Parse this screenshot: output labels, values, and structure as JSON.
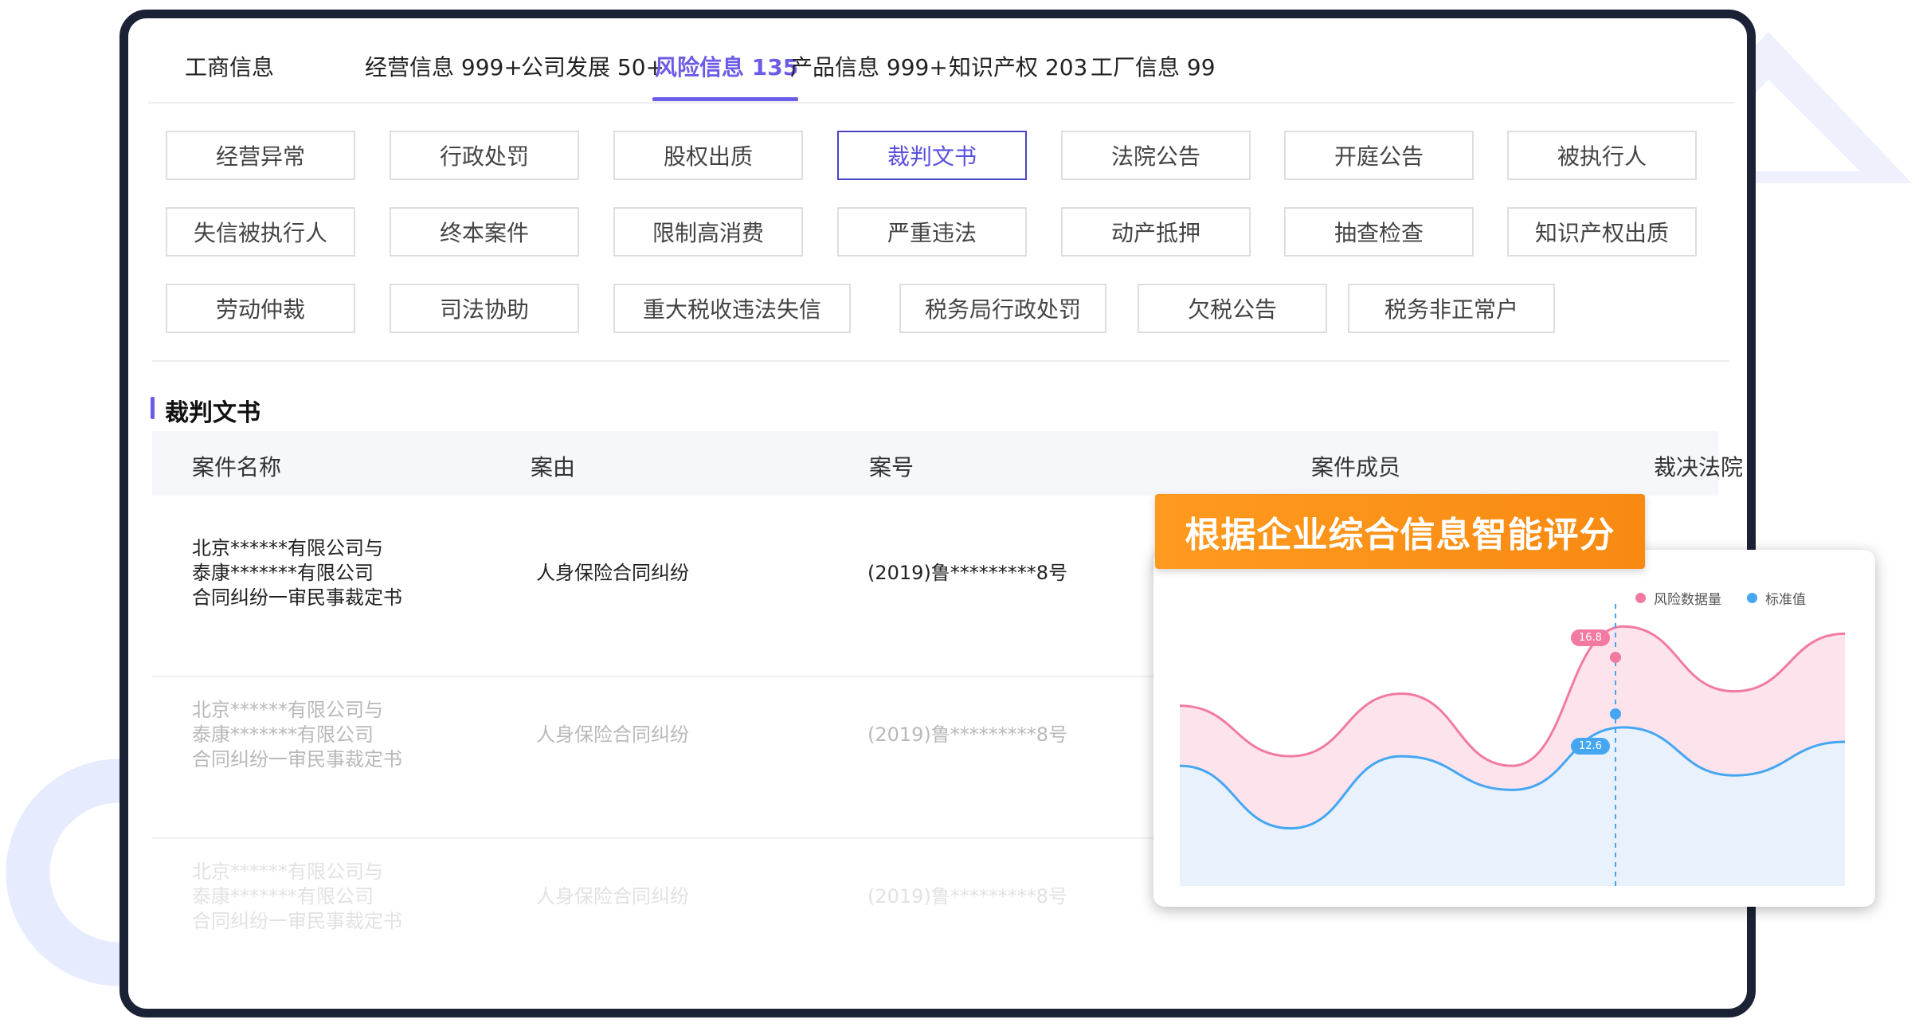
{
  "tabs": [
    {
      "label": "工商信息",
      "active": false
    },
    {
      "label": "经营信息 999+",
      "active": false
    },
    {
      "label": "公司发展 50+",
      "active": false
    },
    {
      "label": "风险信息 135",
      "active": true
    },
    {
      "label": "产品信息 999+",
      "active": false
    },
    {
      "label": "知识产权 203",
      "active": false
    },
    {
      "label": "工厂信息 99",
      "active": false
    }
  ],
  "categories": [
    [
      "经营异常",
      "行政处罚",
      "股权出质",
      "裁判文书",
      "法院公告",
      "开庭公告",
      "被执行人"
    ],
    [
      "失信被执行人",
      "终本案件",
      "限制高消费",
      "严重违法",
      "动产抵押",
      "抽查检查",
      "知识产权出质"
    ],
    [
      "劳动仲裁",
      "司法协助",
      "重大税收违法失信",
      "税务局行政处罚",
      "欠税公告",
      "税务非正常户"
    ]
  ],
  "active_category": "裁判文书",
  "section_title": "裁判文书",
  "table": {
    "headers": [
      "案件名称",
      "案由",
      "案号",
      "案件成员",
      "裁决法院"
    ],
    "rows": [
      {
        "name": [
          "北京******有限公司与",
          "泰康*******有限公司",
          "合同纠纷一审民事裁定书"
        ],
        "cause": "人身保险合同纠纷",
        "case_no": "(2019)鲁*********8号"
      },
      {
        "name": [
          "北京******有限公司与",
          "泰康*******有限公司",
          "合同纠纷一审民事裁定书"
        ],
        "cause": "人身保险合同纠纷",
        "case_no": "(2019)鲁*********8号"
      },
      {
        "name": [
          "北京******有限公司与",
          "泰康*******有限公司",
          "合同纠纷一审民事裁定书"
        ],
        "cause": "人身保险合同纠纷",
        "case_no": "(2019)鲁*********8号"
      }
    ]
  },
  "promo_badge": "根据企业综合信息智能评分",
  "colors": {
    "accent": "#6b5ce7",
    "risk": "#f27aa0",
    "standard": "#45a6f2",
    "badge": "#ff9a1f",
    "frame": "#1c2235"
  },
  "chart_data": {
    "type": "area",
    "legend": [
      {
        "name": "风险数据量",
        "color": "#f27aa0"
      },
      {
        "name": "标准值",
        "color": "#45a6f2"
      }
    ],
    "x": [
      0,
      1,
      2,
      3,
      4,
      5,
      6,
      7,
      8
    ],
    "series": [
      {
        "name": "风险数据量",
        "values": [
          13.5,
          11.4,
          14.0,
          11.0,
          16.8,
          14.1,
          16.5
        ]
      },
      {
        "name": "标准值",
        "values": [
          11.0,
          8.4,
          11.4,
          10.0,
          12.6,
          10.6,
          12.0
        ]
      }
    ],
    "highlight": {
      "risk": "16.8",
      "standard": "12.6"
    },
    "xlabel": "",
    "ylabel": "",
    "grid": false
  }
}
